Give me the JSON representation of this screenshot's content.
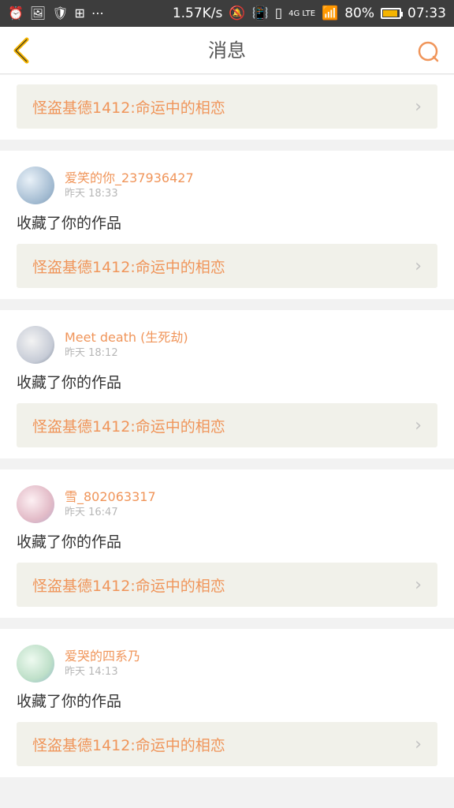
{
  "status": {
    "speed": "1.57K/s",
    "network": "4G LTE",
    "battery": "80%",
    "battery_level": 0.8,
    "time": "07:33"
  },
  "header": {
    "title": "消息"
  },
  "messages": [
    {
      "work_title": "怪盗基德1412:命运中的相恋"
    },
    {
      "username": "爱笑的你_237936427",
      "time": "昨天 18:33",
      "action": "收藏了你的作品",
      "work_title": "怪盗基德1412:命运中的相恋"
    },
    {
      "username": "Meet death (生死劫)",
      "time": "昨天 18:12",
      "action": "收藏了你的作品",
      "work_title": "怪盗基德1412:命运中的相恋"
    },
    {
      "username": "雪_802063317",
      "time": "昨天 16:47",
      "action": "收藏了你的作品",
      "work_title": "怪盗基德1412:命运中的相恋"
    },
    {
      "username": "爱哭的四系乃",
      "time": "昨天 14:13",
      "action": "收藏了你的作品",
      "work_title": "怪盗基德1412:命运中的相恋"
    }
  ],
  "colors": {
    "accent": "#f0955a",
    "status_bg": "#3d3d3d",
    "card_link_bg": "#f1f1ea"
  }
}
